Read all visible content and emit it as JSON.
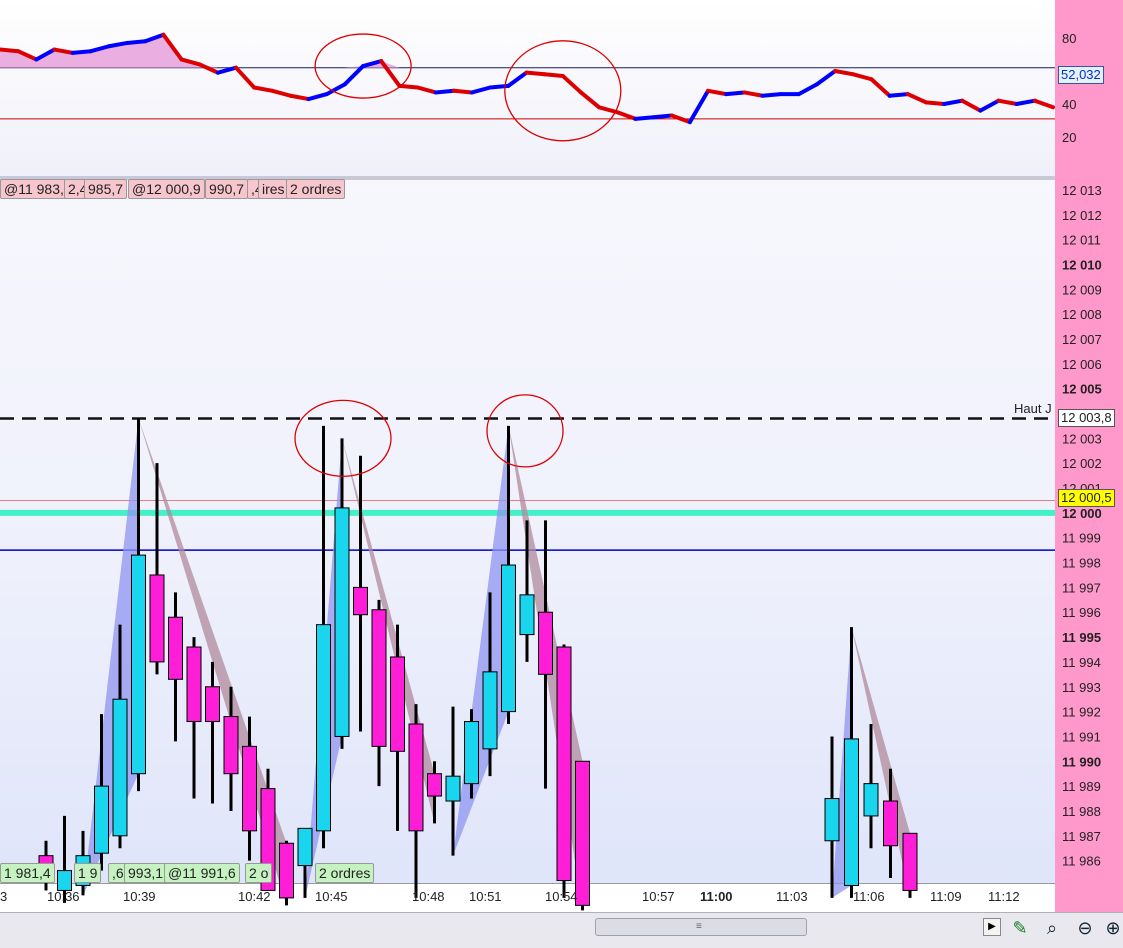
{
  "colors": {
    "bull_candle": "#1ad5ee",
    "bear_candle": "#ff1ed8",
    "osc_up": "#0000ff",
    "osc_down": "#dd0000",
    "osc_fill": "#e8a0dc",
    "right_axis_bg": "#ff99cc",
    "support_line": "#44f0c8",
    "blue_line": "#0000cc",
    "annotation_circle": "#dd0000",
    "highlight_label": "#ffff00"
  },
  "indicator": {
    "y_ticks": [
      "80",
      "60",
      "40",
      "20"
    ],
    "current_value_label": "52,032",
    "upper_level": 62,
    "lower_level": 31
  },
  "price_axis": {
    "ticks": [
      "12 013",
      "12 012",
      "12 011",
      "12 010",
      "12 009",
      "12 008",
      "12 007",
      "12 006",
      "12 005",
      "12 004",
      "12 003",
      "12 002",
      "12 001",
      "12 000",
      "11 999",
      "11 998",
      "11 997",
      "11 996",
      "11 995",
      "11 994",
      "11 993",
      "11 992",
      "11 991",
      "11 990",
      "11 989",
      "11 988",
      "11 987",
      "11 986"
    ],
    "bold_ticks": [
      "12 010",
      "12 005",
      "12 000",
      "11 995",
      "11 990"
    ],
    "dashed_level_label": "Haut J",
    "dashed_level_value": "12 003,8",
    "current_price_label": "12 000,5"
  },
  "time_axis": {
    "labels": [
      "3",
      "10:36",
      "10:39",
      "10:42",
      "10:45",
      "10:48",
      "10:51",
      "10:54",
      "10:57",
      "11:00",
      "11:03",
      "11:06",
      "11:09",
      "11:12"
    ],
    "bold_labels": [
      "11:00"
    ]
  },
  "order_tags": {
    "top": [
      {
        "text": "@11 983,7",
        "style": "pink"
      },
      {
        "text": "2,4",
        "style": "pink"
      },
      {
        "text": "985,7",
        "style": "pink"
      },
      {
        "text": "@12 000,9",
        "style": "pink"
      },
      {
        "text": "990,7",
        "style": "pink"
      },
      {
        "text": ",4",
        "style": "pink"
      },
      {
        "text": "ires",
        "style": "pink"
      },
      {
        "text": "2 ordres",
        "style": "pink"
      }
    ],
    "bottom": [
      {
        "text": "1 981,4",
        "style": "green"
      },
      {
        "text": "1 9",
        "style": "green"
      },
      {
        "text": ",6",
        "style": "green"
      },
      {
        "text": "993,1",
        "style": "green"
      },
      {
        "text": "@11 991,6",
        "style": "green"
      },
      {
        "text": "2 o",
        "style": "green"
      },
      {
        "text": "2 ordres",
        "style": "green"
      }
    ]
  },
  "chart_data": [
    {
      "type": "line",
      "series": [
        {
          "values": [
            73,
            72,
            67,
            73,
            71,
            72,
            75,
            77,
            78,
            82,
            67,
            64,
            59,
            62,
            50,
            48,
            45,
            43,
            46,
            52,
            63,
            66,
            51,
            50,
            47,
            48,
            47,
            50,
            51,
            59,
            58,
            57,
            47,
            38,
            35,
            31,
            32,
            33,
            29,
            48,
            46,
            47,
            45,
            46,
            46,
            52,
            60,
            58,
            55,
            45,
            46,
            41,
            40,
            42,
            36,
            42,
            40,
            42,
            38
          ]
        }
      ],
      "ylim": [
        0,
        100
      ],
      "hlines": [
        62,
        31
      ],
      "annotations": [
        {
          "label": "circle",
          "x_index": 20,
          "y": 63
        },
        {
          "label": "circle",
          "x_index": 31,
          "y": 48
        }
      ]
    },
    {
      "type": "candlestick",
      "ylim": [
        11985.1,
        12013.4
      ],
      "hlines": [
        {
          "value": 12003.8,
          "style": "dashed"
        },
        {
          "value": 12000.5,
          "style": "thin-red"
        },
        {
          "value": 12000.0,
          "style": "thick-teal"
        },
        {
          "value": 11998.5,
          "style": "thin-blue"
        }
      ],
      "candles": [
        {
          "time": "10:36",
          "o": 11986.2,
          "h": 11986.8,
          "l": 11984.8,
          "c": 11985.2
        },
        {
          "time": "10:37",
          "o": 11984.8,
          "h": 11987.8,
          "l": 11984.3,
          "c": 11985.6
        },
        {
          "time": "10:37",
          "o": 11985.0,
          "h": 11987.2,
          "l": 11984.6,
          "c": 11986.2
        },
        {
          "time": "10:38",
          "o": 11986.3,
          "h": 11991.9,
          "l": 11985.6,
          "c": 11989.0
        },
        {
          "time": "10:38",
          "o": 11987.0,
          "h": 11995.5,
          "l": 11986.5,
          "c": 11992.5
        },
        {
          "time": "10:39",
          "o": 11989.5,
          "h": 12003.8,
          "l": 11988.8,
          "c": 11998.3
        },
        {
          "time": "10:39",
          "o": 11997.5,
          "h": 12002.0,
          "l": 11993.5,
          "c": 11994.0
        },
        {
          "time": "10:40",
          "o": 11995.8,
          "h": 11996.8,
          "l": 11990.8,
          "c": 11993.3
        },
        {
          "time": "10:40",
          "o": 11994.6,
          "h": 11995.0,
          "l": 11988.5,
          "c": 11991.6
        },
        {
          "time": "10:41",
          "o": 11993.0,
          "h": 11994.0,
          "l": 11988.3,
          "c": 11991.6
        },
        {
          "time": "10:41",
          "o": 11991.8,
          "h": 11993.0,
          "l": 11988.0,
          "c": 11989.5
        },
        {
          "time": "10:42",
          "o": 11990.6,
          "h": 11991.8,
          "l": 11986.0,
          "c": 11987.2
        },
        {
          "time": "10:42",
          "o": 11988.9,
          "h": 11989.7,
          "l": 11985.0,
          "c": 11984.8
        },
        {
          "time": "10:43",
          "o": 11986.7,
          "h": 11986.8,
          "l": 11984.2,
          "c": 11984.5
        },
        {
          "time": "10:44",
          "o": 11985.8,
          "h": 11987.3,
          "l": 11984.5,
          "c": 11987.3
        },
        {
          "time": "10:44",
          "o": 11987.2,
          "h": 12003.5,
          "l": 11986.5,
          "c": 11995.5
        },
        {
          "time": "10:45",
          "o": 11991.0,
          "h": 12003.0,
          "l": 11990.5,
          "c": 12000.2
        },
        {
          "time": "10:46",
          "o": 11997.0,
          "h": 12002.3,
          "l": 11991.2,
          "c": 11995.9
        },
        {
          "time": "10:46",
          "o": 11996.1,
          "h": 11996.5,
          "l": 11989.0,
          "c": 11990.6
        },
        {
          "time": "10:47",
          "o": 11994.2,
          "h": 11995.5,
          "l": 11987.2,
          "c": 11990.4
        },
        {
          "time": "10:47",
          "o": 11991.5,
          "h": 11992.3,
          "l": 11984.5,
          "c": 11987.2
        },
        {
          "time": "10:48",
          "o": 11989.5,
          "h": 11990.0,
          "l": 11987.5,
          "c": 11988.6
        },
        {
          "time": "10:49",
          "o": 11988.4,
          "h": 11992.2,
          "l": 11986.2,
          "c": 11989.4
        },
        {
          "time": "10:49",
          "o": 11989.1,
          "h": 11992.1,
          "l": 11988.5,
          "c": 11991.6
        },
        {
          "time": "10:50",
          "o": 11990.5,
          "h": 11996.8,
          "l": 11989.4,
          "c": 11993.6
        },
        {
          "time": "10:51",
          "o": 11992.0,
          "h": 12003.5,
          "l": 11991.5,
          "c": 11997.9
        },
        {
          "time": "10:52",
          "o": 11995.1,
          "h": 11999.7,
          "l": 11994.0,
          "c": 11996.7
        },
        {
          "time": "10:52",
          "o": 11996.0,
          "h": 11999.7,
          "l": 11988.9,
          "c": 11993.5
        },
        {
          "time": "10:53",
          "o": 11994.6,
          "h": 11994.7,
          "l": 11984.5,
          "c": 11985.2
        },
        {
          "time": "10:54",
          "o": 11990.0,
          "h": 11990.0,
          "l": 11984.0,
          "c": 11984.2
        },
        {
          "time": "11:04",
          "o": 11986.8,
          "h": 11991.0,
          "l": 11984.5,
          "c": 11988.5
        },
        {
          "time": "11:05",
          "o": 11985.0,
          "h": 11995.4,
          "l": 11984.5,
          "c": 11990.9
        },
        {
          "time": "11:05",
          "o": 11987.8,
          "h": 11991.5,
          "l": 11986.5,
          "c": 11989.1
        },
        {
          "time": "11:06",
          "o": 11988.4,
          "h": 11989.7,
          "l": 11985.3,
          "c": 11986.6
        },
        {
          "time": "11:07",
          "o": 11987.1,
          "h": 11987.1,
          "l": 11984.5,
          "c": 11984.8
        }
      ],
      "annotations": [
        {
          "label": "circle",
          "time": "10:45",
          "y": 12003.0
        },
        {
          "label": "circle",
          "time": "10:51",
          "y": 12003.3
        }
      ]
    }
  ]
}
